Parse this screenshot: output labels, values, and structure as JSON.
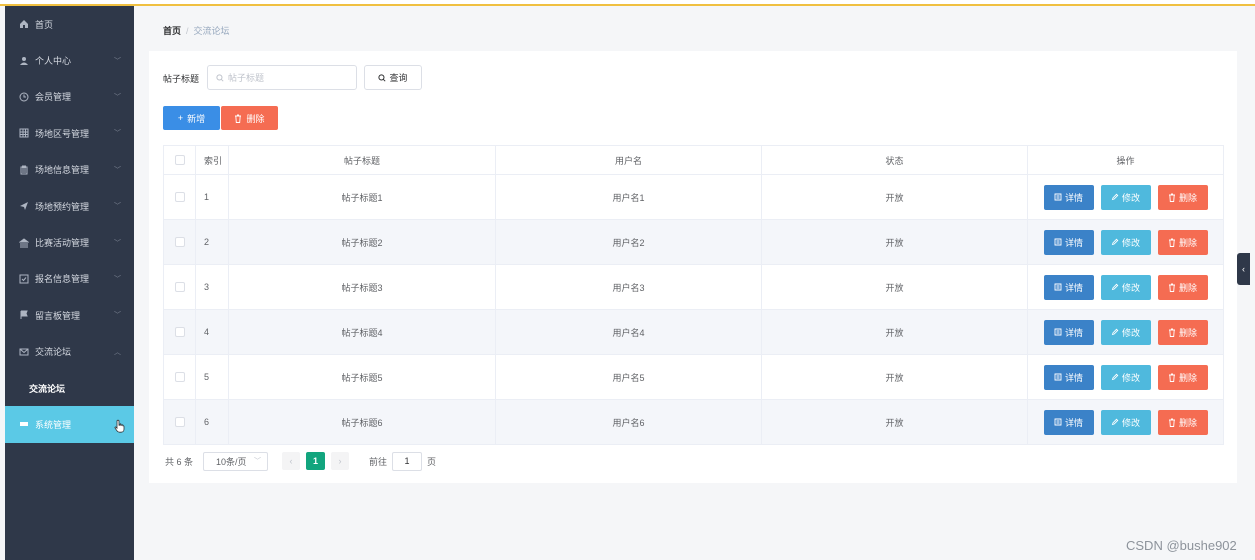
{
  "sidebar": {
    "items": [
      {
        "label": "首页",
        "icon": "home-icon"
      },
      {
        "label": "个人中心",
        "icon": "user-icon"
      },
      {
        "label": "会员管理",
        "icon": "clock-icon"
      },
      {
        "label": "场地区号管理",
        "icon": "grid-icon"
      },
      {
        "label": "场地信息管理",
        "icon": "clipboard-icon"
      },
      {
        "label": "场地预约管理",
        "icon": "send-icon"
      },
      {
        "label": "比赛活动管理",
        "icon": "bank-icon"
      },
      {
        "label": "报名信息管理",
        "icon": "checklist-icon"
      },
      {
        "label": "留言板管理",
        "icon": "flag-icon"
      },
      {
        "label": "交流论坛",
        "icon": "mail-icon"
      },
      {
        "label": "交流论坛"
      },
      {
        "label": "系统管理",
        "icon": "ticket-icon"
      }
    ]
  },
  "breadcrumb": {
    "home": "首页",
    "sep": "/",
    "current": "交流论坛"
  },
  "search": {
    "label": "帖子标题",
    "placeholder": "帖子标题",
    "button": "查询"
  },
  "toolbar": {
    "add": "新增",
    "delete": "删除"
  },
  "table": {
    "headers": {
      "index": "索引",
      "title": "帖子标题",
      "user": "用户名",
      "status": "状态",
      "actions": "操作"
    },
    "rows": [
      {
        "index": "1",
        "title": "帖子标题1",
        "user": "用户名1",
        "status": "开放"
      },
      {
        "index": "2",
        "title": "帖子标题2",
        "user": "用户名2",
        "status": "开放"
      },
      {
        "index": "3",
        "title": "帖子标题3",
        "user": "用户名3",
        "status": "开放"
      },
      {
        "index": "4",
        "title": "帖子标题4",
        "user": "用户名4",
        "status": "开放"
      },
      {
        "index": "5",
        "title": "帖子标题5",
        "user": "用户名5",
        "status": "开放"
      },
      {
        "index": "6",
        "title": "帖子标题6",
        "user": "用户名6",
        "status": "开放"
      }
    ],
    "actions": {
      "detail": "详情",
      "edit": "修改",
      "delete": "删除"
    }
  },
  "pager": {
    "total": "共 6 条",
    "page_size": "10条/页",
    "current_page": "1",
    "goto": "前往",
    "goto_value": "1",
    "page_unit": "页"
  },
  "watermark": "CSDN @bushe902",
  "colors": {
    "sidebar_bg": "#2f3849",
    "active": "#5bc9e6",
    "primary": "#3a8ee6",
    "danger": "#f56c52",
    "info": "#4fb9dd",
    "pager_active": "#12a57e"
  }
}
